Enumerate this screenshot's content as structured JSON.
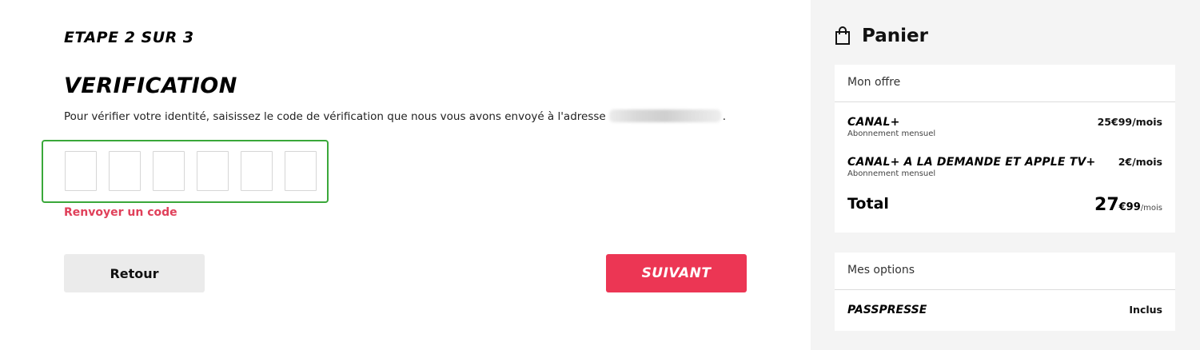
{
  "step": {
    "label": "ETAPE 2 SUR 3"
  },
  "verification": {
    "title": "VERIFICATION",
    "description": "Pour vérifier votre identité, saisissez le code de vérification que nous vous avons envoyé à l'adresse",
    "description_end": ".",
    "code_digits": [
      "",
      "",
      "",
      "",
      "",
      ""
    ],
    "resend_label": "Renvoyer un code"
  },
  "buttons": {
    "back_label": "Retour",
    "next_label": "SUIVANT"
  },
  "cart": {
    "title": "Panier",
    "offer_section": "Mon offre",
    "items": [
      {
        "name": "CANAL+",
        "subtitle": "Abonnement mensuel",
        "price": "25€99/mois"
      },
      {
        "name": "CANAL+ A LA DEMANDE ET APPLE TV+",
        "subtitle": "Abonnement mensuel",
        "price": "2€/mois"
      }
    ],
    "total": {
      "label": "Total",
      "whole": "27",
      "cents": "€99",
      "unit": "/mois"
    },
    "options_section": "Mes options",
    "options": [
      {
        "name": "PASSPRESSE",
        "price": "Inclus"
      }
    ]
  },
  "colors": {
    "accent": "#ec3654",
    "link": "#e0405a",
    "focus_border": "#3aa83a"
  }
}
